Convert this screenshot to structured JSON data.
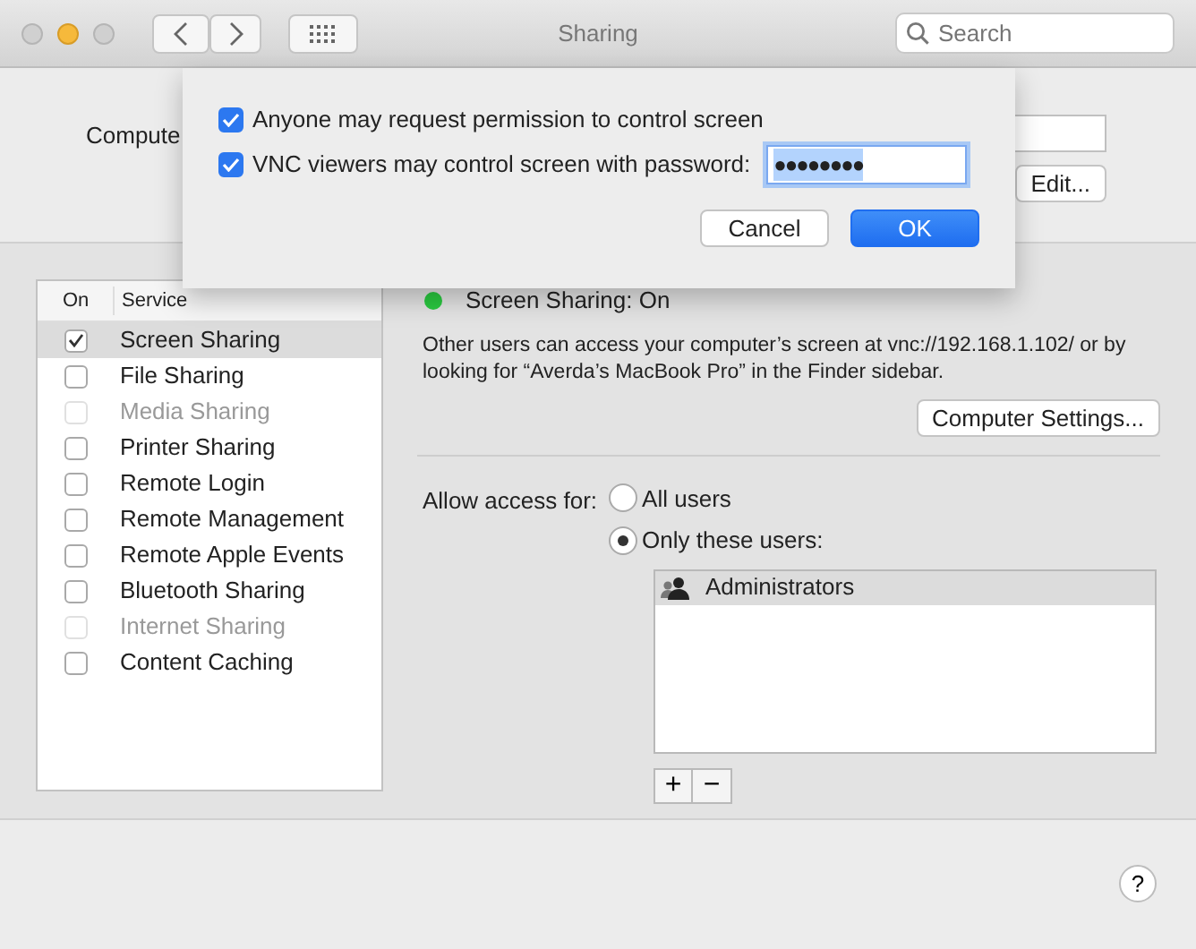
{
  "window": {
    "title": "Sharing"
  },
  "search": {
    "placeholder": "Search"
  },
  "computer_name": {
    "label": "Compute"
  },
  "edit_button": "Edit...",
  "sheet": {
    "options": [
      {
        "label": "Anyone may request permission to control screen",
        "checked": true
      },
      {
        "label": "VNC viewers may control screen with password:",
        "checked": true,
        "password": "●●●●●●●●"
      }
    ],
    "buttons": [
      {
        "label": "Cancel",
        "kind": "plain"
      },
      {
        "label": "OK",
        "kind": "default"
      }
    ]
  },
  "services": {
    "columns": [
      "On",
      "Service"
    ],
    "rows": [
      {
        "name": "Screen Sharing",
        "checked": true,
        "disabled": false,
        "selected": true
      },
      {
        "name": "File Sharing",
        "checked": false,
        "disabled": false,
        "selected": false
      },
      {
        "name": "Media Sharing",
        "checked": false,
        "disabled": true,
        "selected": false
      },
      {
        "name": "Printer Sharing",
        "checked": false,
        "disabled": false,
        "selected": false
      },
      {
        "name": "Remote Login",
        "checked": false,
        "disabled": false,
        "selected": false
      },
      {
        "name": "Remote Management",
        "checked": false,
        "disabled": false,
        "selected": false
      },
      {
        "name": "Remote Apple Events",
        "checked": false,
        "disabled": false,
        "selected": false
      },
      {
        "name": "Bluetooth Sharing",
        "checked": false,
        "disabled": false,
        "selected": false
      },
      {
        "name": "Internet Sharing",
        "checked": false,
        "disabled": true,
        "selected": false
      },
      {
        "name": "Content Caching",
        "checked": false,
        "disabled": false,
        "selected": false
      }
    ]
  },
  "status": {
    "text": "Screen Sharing: On",
    "on": true
  },
  "description": "Other users can access your computer’s screen at vnc://192.168.1.102/ or by looking for “Averda’s MacBook Pro” in the Finder sidebar.",
  "computer_settings_button": "Computer Settings...",
  "access": {
    "label": "Allow access for:",
    "options": [
      {
        "label": "All users",
        "selected": false
      },
      {
        "label": "Only these users:",
        "selected": true
      }
    ],
    "users": [
      {
        "name": "Administrators",
        "selected": true
      }
    ],
    "add": "+",
    "remove": "−"
  },
  "help": "?"
}
